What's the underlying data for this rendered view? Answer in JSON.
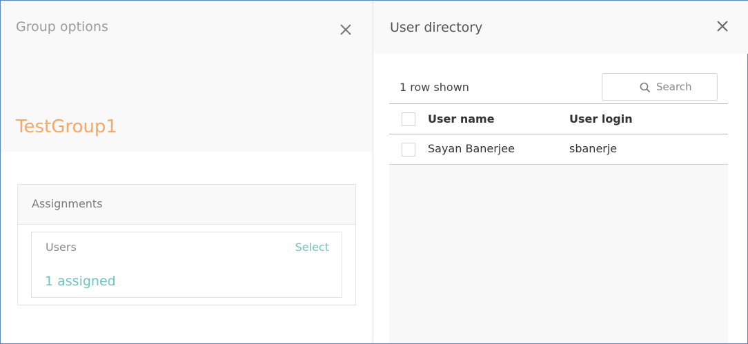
{
  "group_panel": {
    "title": "Group options",
    "close_icon": "close-icon",
    "group_name": "TestGroup1",
    "assignments": {
      "title": "Assignments",
      "users": {
        "label": "Users",
        "select_label": "Select",
        "assigned_text": "1 assigned"
      }
    }
  },
  "directory_panel": {
    "title": "User directory",
    "close_icon": "close-icon",
    "rows_shown": "1 row shown",
    "search": {
      "label": "Search",
      "icon": "search-icon"
    },
    "table": {
      "columns": [
        "User name",
        "User login"
      ],
      "rows": [
        {
          "name": "Sayan Banerjee",
          "login": "sbanerje"
        }
      ]
    }
  },
  "colors": {
    "accent_orange": "#f4a86a",
    "accent_teal": "#6cc5c3",
    "frame_border": "#5a86c4"
  }
}
